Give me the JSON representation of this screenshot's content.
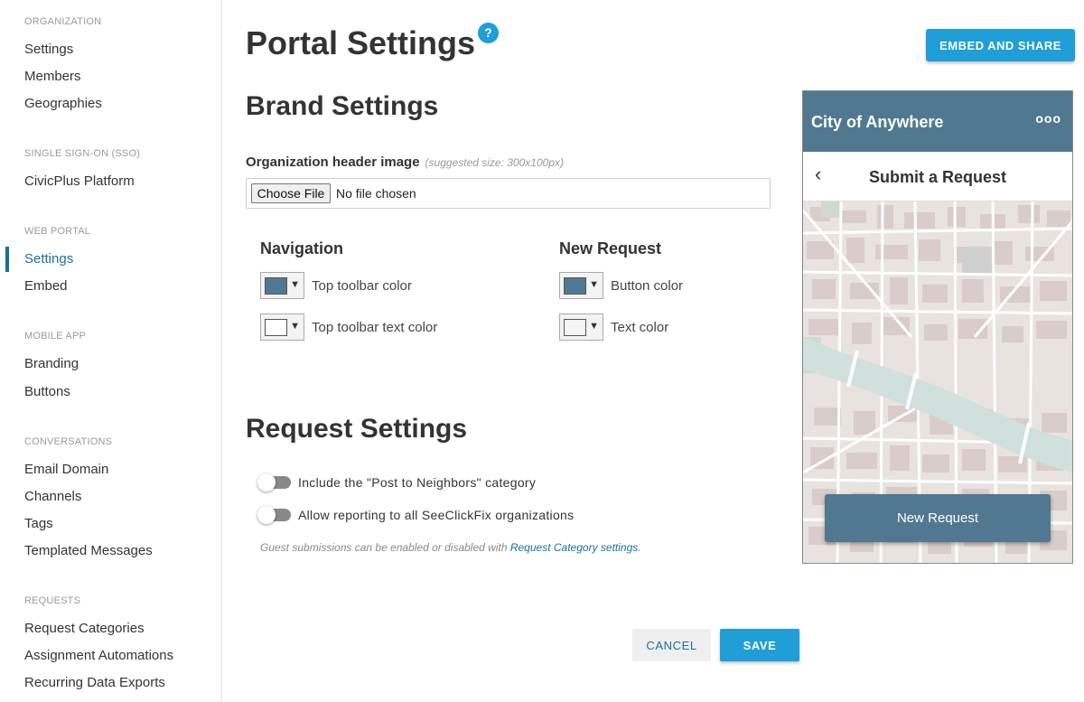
{
  "sidebar": {
    "sections": [
      {
        "title": "ORGANIZATION",
        "items": [
          "Settings",
          "Members",
          "Geographies"
        ]
      },
      {
        "title": "SINGLE SIGN-ON (SSO)",
        "items": [
          "CivicPlus Platform"
        ]
      },
      {
        "title": "WEB PORTAL",
        "items": [
          "Settings",
          "Embed"
        ]
      },
      {
        "title": "MOBILE APP",
        "items": [
          "Branding",
          "Buttons"
        ]
      },
      {
        "title": "CONVERSATIONS",
        "items": [
          "Email Domain",
          "Channels",
          "Tags",
          "Templated Messages"
        ]
      },
      {
        "title": "REQUESTS",
        "items": [
          "Request Categories",
          "Assignment Automations",
          "Recurring Data Exports"
        ]
      }
    ],
    "active_item": "WEB PORTAL / Settings"
  },
  "header": {
    "title": "Portal Settings",
    "help_label": "?",
    "embed_button": "EMBED AND SHARE"
  },
  "brand": {
    "heading": "Brand Settings",
    "header_image_label": "Organization header image",
    "header_image_hint": "(suggested size: 300x100px)",
    "choose_file_label": "Choose File",
    "file_status": "No file chosen",
    "navigation": {
      "heading": "Navigation",
      "toolbar_color_label": "Top toolbar color",
      "toolbar_color": "#517891",
      "toolbar_text_color_label": "Top toolbar text color",
      "toolbar_text_color": "#ffffff"
    },
    "new_request": {
      "heading": "New Request",
      "button_color_label": "Button color",
      "button_color": "#517891",
      "text_color_label": "Text color",
      "text_color": "#f5f5f5"
    }
  },
  "request": {
    "heading": "Request Settings",
    "toggle_neighbors_label": "Include the \"Post to Neighbors\" category",
    "toggle_neighbors_on": false,
    "toggle_all_orgs_label": "Allow reporting to all SeeClickFix organizations",
    "toggle_all_orgs_on": false,
    "guest_note": "Guest submissions can be enabled or disabled with",
    "guest_link": "Request Category settings",
    "guest_note_end": "."
  },
  "actions": {
    "cancel": "CANCEL",
    "save": "SAVE"
  },
  "preview": {
    "toolbar_title": "City of Anywhere",
    "menu_dots": "ooo",
    "back": "‹",
    "subtitle": "Submit a Request",
    "button_label": "New Request",
    "toolbar_color": "#517891"
  }
}
